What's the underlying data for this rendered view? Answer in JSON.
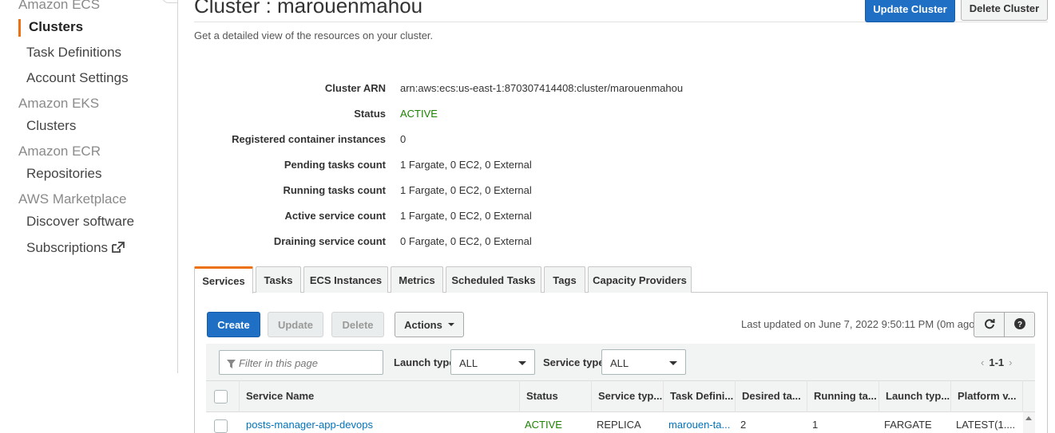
{
  "sidebar": {
    "sections": [
      {
        "title": "Amazon ECS",
        "items": [
          "Clusters",
          "Task Definitions",
          "Account Settings"
        ]
      },
      {
        "title": "Amazon EKS",
        "items": [
          "Clusters"
        ]
      },
      {
        "title": "Amazon ECR",
        "items": [
          "Repositories"
        ]
      },
      {
        "title": "AWS Marketplace",
        "items": [
          "Discover software",
          "Subscriptions"
        ]
      }
    ],
    "active_item": "Clusters",
    "external_icon": "external-link-icon"
  },
  "header": {
    "title": "Cluster : marouenmahou",
    "subtitle": "Get a detailed view of the resources on your cluster.",
    "update_cluster_label": "Update Cluster",
    "delete_cluster_label": "Delete Cluster"
  },
  "details": [
    {
      "label": "Cluster ARN",
      "value": "arn:aws:ecs:us-east-1:870307414408:cluster/marouenmahou"
    },
    {
      "label": "Status",
      "value": "ACTIVE"
    },
    {
      "label": "Registered container instances",
      "value": "0"
    },
    {
      "label": "Pending tasks count",
      "value": "1 Fargate, 0 EC2, 0 External"
    },
    {
      "label": "Running tasks count",
      "value": "1 Fargate, 0 EC2, 0 External"
    },
    {
      "label": "Active service count",
      "value": "1 Fargate, 0 EC2, 0 External"
    },
    {
      "label": "Draining service count",
      "value": "0 Fargate, 0 EC2, 0 External"
    }
  ],
  "tabs": [
    {
      "label": "Services",
      "active": true
    },
    {
      "label": "Tasks"
    },
    {
      "label": "ECS Instances"
    },
    {
      "label": "Metrics"
    },
    {
      "label": "Scheduled Tasks"
    },
    {
      "label": "Tags"
    },
    {
      "label": "Capacity Providers"
    }
  ],
  "toolbar": {
    "create_label": "Create",
    "update_label": "Update",
    "delete_label": "Delete",
    "actions_label": "Actions",
    "last_updated": "Last updated on June 7, 2022 9:50:11 PM (0m ago)"
  },
  "filters": {
    "placeholder": "Filter in this page",
    "launch_type_label": "Launch type",
    "launch_type_value": "ALL",
    "service_type_label": "Service type",
    "service_type_value": "ALL",
    "pager": "1-1"
  },
  "table": {
    "columns": [
      "Service Name",
      "Status",
      "Service typ...",
      "Task Defini...",
      "Desired ta...",
      "Running ta...",
      "Launch typ...",
      "Platform v..."
    ],
    "rows": [
      [
        "posts-manager-app-devops",
        "ACTIVE",
        "REPLICA",
        "marouen-ta...",
        "2",
        "1",
        "FARGATE",
        "LATEST(1...."
      ]
    ]
  },
  "colors": {
    "accent_orange": "#ec7211",
    "primary_blue": "#1f6fc5",
    "link_blue": "#0073bb",
    "status_green": "#1d8102"
  }
}
